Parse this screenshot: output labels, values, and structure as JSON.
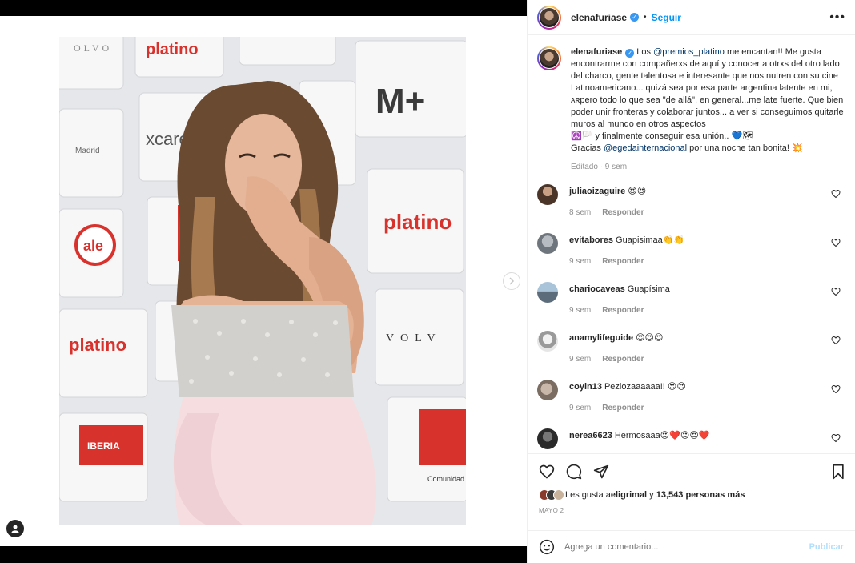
{
  "header": {
    "username": "elenafuriase",
    "follow_label": "Seguir",
    "more_icon": "more-options-icon"
  },
  "caption": {
    "username": "elenafuriase",
    "text_1": "Los ",
    "mention_1": "@premios_platino",
    "text_2": " me encantan!! Me gusta encontrarme con compañerxs de aquí y conocer a otrxs del otro lado del charco, gente talentosa e interesante que nos nutren con su cine Latinoamericano... quizá sea por esa parte argentina latente en mi, ᴀʀpero todo lo que sea \"de allá\", en general...me late fuerte. Que bien poder unir fronteras y colaborar juntos... a ver si conseguimos quitarle muros al mundo en otros aspectos",
    "text_3": "☮️🏳️ y finalmente conseguir esa unión.. 💙🗺",
    "text_4": "Gracias ",
    "mention_2": "@egedainternacional",
    "text_5": " por una noche tan bonita! 💥",
    "meta": "Editado · 9 sem"
  },
  "comments": [
    {
      "username": "juliaoizaguire",
      "text": "😍😍",
      "time": "8 sem",
      "reply": "Responder",
      "avatar_color": "#6b5a4e"
    },
    {
      "username": "evitabores",
      "text": "Guapisimaa👏👏",
      "time": "9 sem",
      "reply": "Responder",
      "avatar_color": "#8a9099"
    },
    {
      "username": "chariocaveas",
      "text": "Guapísima",
      "time": "9 sem",
      "reply": "Responder",
      "avatar_color": "#5d6c7a"
    },
    {
      "username": "anamylifeguide",
      "text": "😍😍😍",
      "time": "9 sem",
      "reply": "Responder",
      "avatar_color": "#b8b8b8"
    },
    {
      "username": "coyin13",
      "text": "Peziozaaaaaa!! 😍😍",
      "time": "9 sem",
      "reply": "Responder",
      "avatar_color": "#9c8f86"
    },
    {
      "username": "nerea6623",
      "text": "Hermosaaa😍❤️😍😍❤️",
      "time": "",
      "reply": "",
      "avatar_color": "#3b3b3b"
    }
  ],
  "actions": {
    "likes_prefix": "Les gusta a ",
    "likes_user": "eligrimal",
    "likes_mid": " y ",
    "likes_count": "13,543 personas más",
    "date": "MAYO 2"
  },
  "add_comment": {
    "placeholder": "Agrega un comentario...",
    "publish_label": "Publicar"
  },
  "colors": {
    "accent": "#0095f6",
    "publish_disabled": "#b2dffc",
    "muted": "#8e8e8e"
  }
}
